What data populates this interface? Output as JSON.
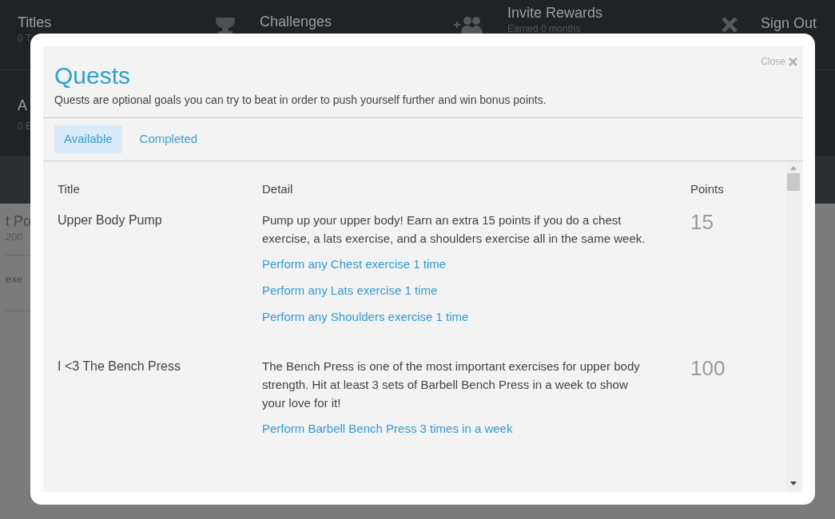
{
  "background": {
    "nav": [
      {
        "kind": "stat",
        "label": "Titles",
        "sub": "0 T"
      },
      {
        "kind": "link",
        "label": "Challenges"
      },
      {
        "kind": "stat",
        "label": "Invite Rewards",
        "sub": "Earned 0 months"
      },
      {
        "kind": "link",
        "label": "Sign Out"
      }
    ],
    "side_stat": {
      "label": "A",
      "sub": "0 E"
    },
    "side_rows": [
      {
        "label": "t Po",
        "sub": "200"
      },
      {
        "label": "exe"
      }
    ]
  },
  "modal": {
    "close": "Close",
    "title": "Quests",
    "description": "Quests are optional goals you can try to beat in order to push yourself further and win bonus points.",
    "tabs": [
      {
        "label": "Available",
        "selected": true
      },
      {
        "label": "Completed",
        "selected": false
      }
    ],
    "table": {
      "columns": [
        "Title",
        "Detail",
        "Points"
      ],
      "rows": [
        {
          "title": "Upper Body Pump",
          "detail": "Pump up your upper body! Earn an extra 15 points if you do a chest exercise, a lats exercise, and a shoulders exercise all in the same week.",
          "tasks": [
            "Perform any Chest exercise 1 time",
            "Perform any Lats exercise 1 time",
            "Perform any Shoulders exercise 1 time"
          ],
          "points": "15"
        },
        {
          "title": "I <3 The Bench Press",
          "detail": "The Bench Press is one of the most important exercises for upper body strength. Hit at least 3 sets of Barbell Bench Press in a week to show your love for it!",
          "tasks": [
            "Perform Barbell Bench Press 3 times in a week"
          ],
          "points": "100"
        }
      ]
    }
  }
}
